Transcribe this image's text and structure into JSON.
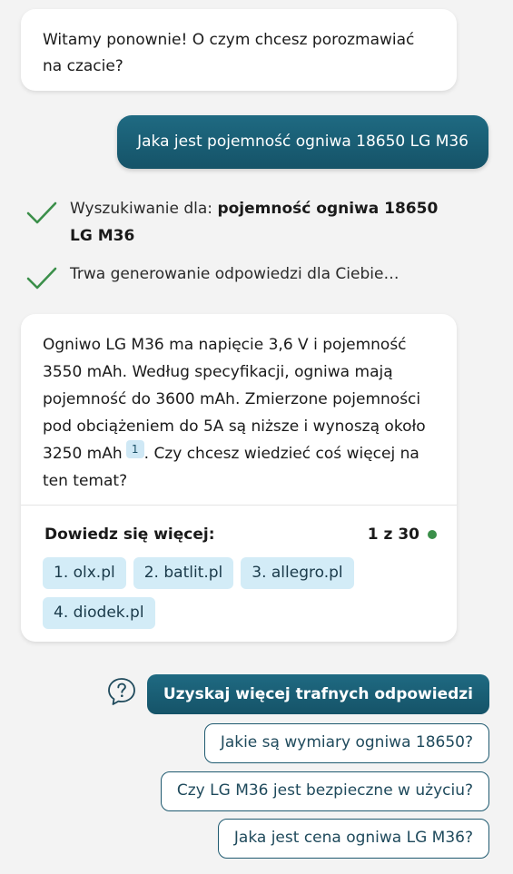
{
  "greeting": {
    "text": "Witamy ponownie! O czym chcesz porozmawiać na czacie?"
  },
  "user_message": {
    "text": "Jaka jest pojemność ogniwa 18650 LG M36"
  },
  "status": {
    "search_prefix": "Wyszukiwanie dla: ",
    "search_query": "pojemność ogniwa 18650 LG M36",
    "generating": "Trwa generowanie odpowiedzi dla Ciebie…",
    "check_icon": "checkmark-icon",
    "check_color": "#3b8f4a"
  },
  "answer": {
    "text": "Ogniwo LG M36 ma napięcie 3,6 V i pojemność 3550 mAh. Według specyfikacji, ogniwa mają pojemność do 3600 mAh. Zmierzone pojemności pod obciążeniem do 5A są niższe i wynoszą około 3250 mAh",
    "citation": "1",
    "after_citation": ".",
    "follow_question": "Czy chcesz wiedzieć coś więcej na ten temat?",
    "learn_more_label": "Dowiedz się więcej:",
    "counter": "1 z 30",
    "sources": [
      "1. olx.pl",
      "2. batlit.pl",
      "3. allegro.pl",
      "4. diodek.pl"
    ]
  },
  "actions": {
    "help_icon": "question-icon",
    "cta_label": "Uzyskaj więcej trafnych odpowiedzi",
    "suggestions": [
      "Jakie są wymiary ogniwa 18650?",
      "Czy LG M36 jest bezpieczne w użyciu?",
      "Jaka jest cena ogniwa LG M36?"
    ]
  },
  "colors": {
    "accent": "#1f6a82",
    "chip": "#d3ecf7",
    "background": "#f3f3f3"
  }
}
